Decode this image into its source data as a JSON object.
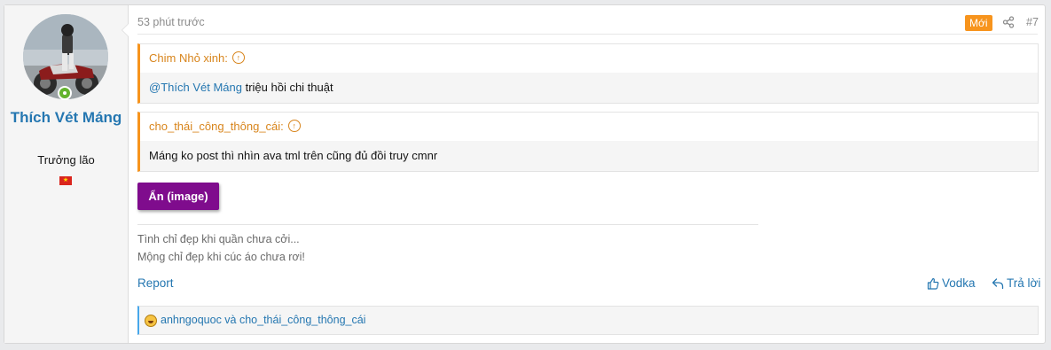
{
  "user": {
    "name": "Thích Vét Máng",
    "title": "Trưởng lão",
    "flag_icon": "vietnam-flag-icon",
    "online_color": "#63b32d"
  },
  "post": {
    "time": "53 phút trước",
    "badge": "Mới",
    "number": "#7",
    "quotes": [
      {
        "author": "Chim Nhỏ xinh:",
        "mention": "@Thích Vét Máng",
        "text": " triệu hồi chi thuật"
      },
      {
        "author": "cho_thái_công_thông_cái:",
        "mention": "",
        "text": "Máng ko post thì nhìn ava tml trên cũng đủ đồi truy cmnr"
      }
    ],
    "spoiler_label": "Ẩn (image)",
    "signature": [
      "Tình chỉ đẹp khi quần chưa cởi...",
      "Mộng chỉ đẹp khi cúc áo chưa rơi!"
    ],
    "report": "Report",
    "like": "Vodka",
    "reply": "Trả lời",
    "reactions": "anhngoquoc và cho_thái_công_thông_cái"
  },
  "colors": {
    "accent": "#2577b1",
    "quote_border": "#f7941d",
    "spoiler": "#7f0c8d",
    "new_badge": "#f7941d"
  }
}
